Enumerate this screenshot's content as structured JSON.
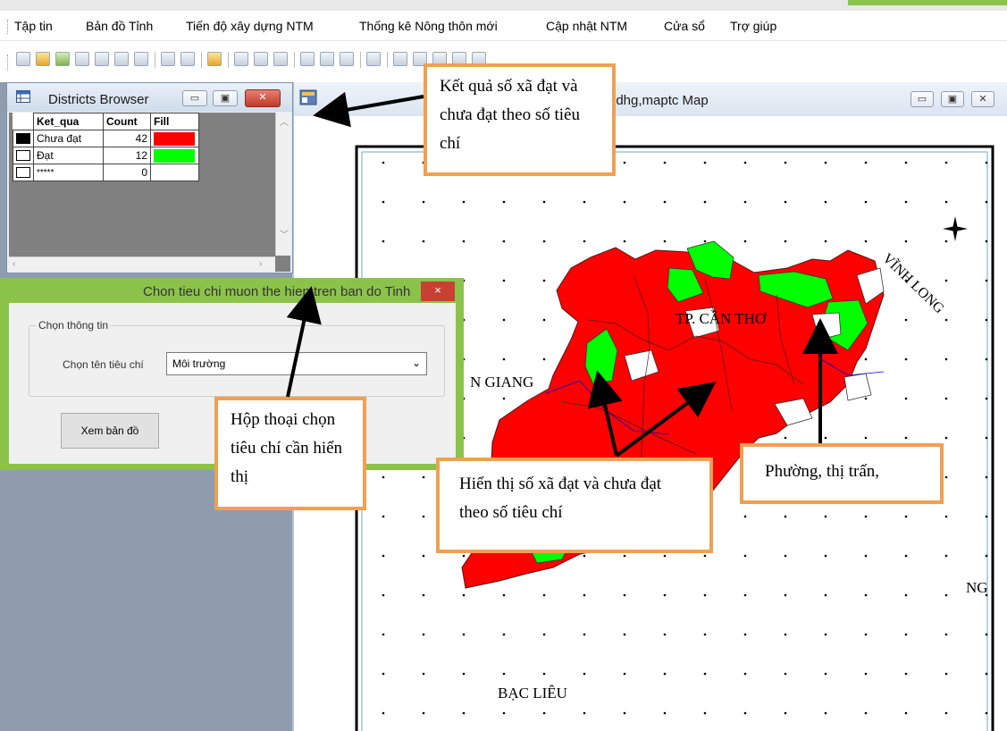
{
  "menubar": {
    "items": [
      "Tập tin",
      "Bản đồ Tỉnh",
      "Tiến độ xây dựng NTM",
      "Thống kê Nông thôn mới",
      "Cập nhật NTM",
      "Cửa sổ",
      "Trợ giúp"
    ]
  },
  "browser": {
    "title": "Districts Browser",
    "columns": [
      "Ket_qua",
      "Count",
      "Fill"
    ],
    "rows": [
      {
        "label": "Chưa đạt",
        "count": "42",
        "fill": "#ff0000"
      },
      {
        "label": "Đạt",
        "count": "12",
        "fill": "#00ff00"
      },
      {
        "label": "*****",
        "count": "0",
        "fill": "#ffffff"
      }
    ]
  },
  "map_window": {
    "title": "bdhg,maptc Map"
  },
  "map": {
    "labels": {
      "can_tho": "TP. CẦN THƠ",
      "vinh_long": "VĨNH LONG",
      "kien_giang": "N GIANG",
      "bac_lieu": "BẠC LIÊU",
      "soc_trang": "NG"
    }
  },
  "dialog": {
    "title": "Chon tieu chi muon the hien tren ban do Tinh",
    "close": "×",
    "group_label": "Chọn thông tin",
    "criteria_label": "Chọn tên tiêu chí",
    "criteria_value": "Môi trường",
    "view_button": "Xem bản đồ"
  },
  "callouts": {
    "result": "Kết quả số xã đạt và chưa đạt theo số tiêu chí",
    "dialog": "Hộp thoại chọn tiêu chí cần hiển thị",
    "display": "Hiển thị số xã đạt và chưa đạt theo số tiêu chí",
    "ward": "Phường, thị trấn,"
  },
  "colors": {
    "not_achieved": "#ff0000",
    "achieved": "#00ff00",
    "callout_border": "#f0a050"
  }
}
